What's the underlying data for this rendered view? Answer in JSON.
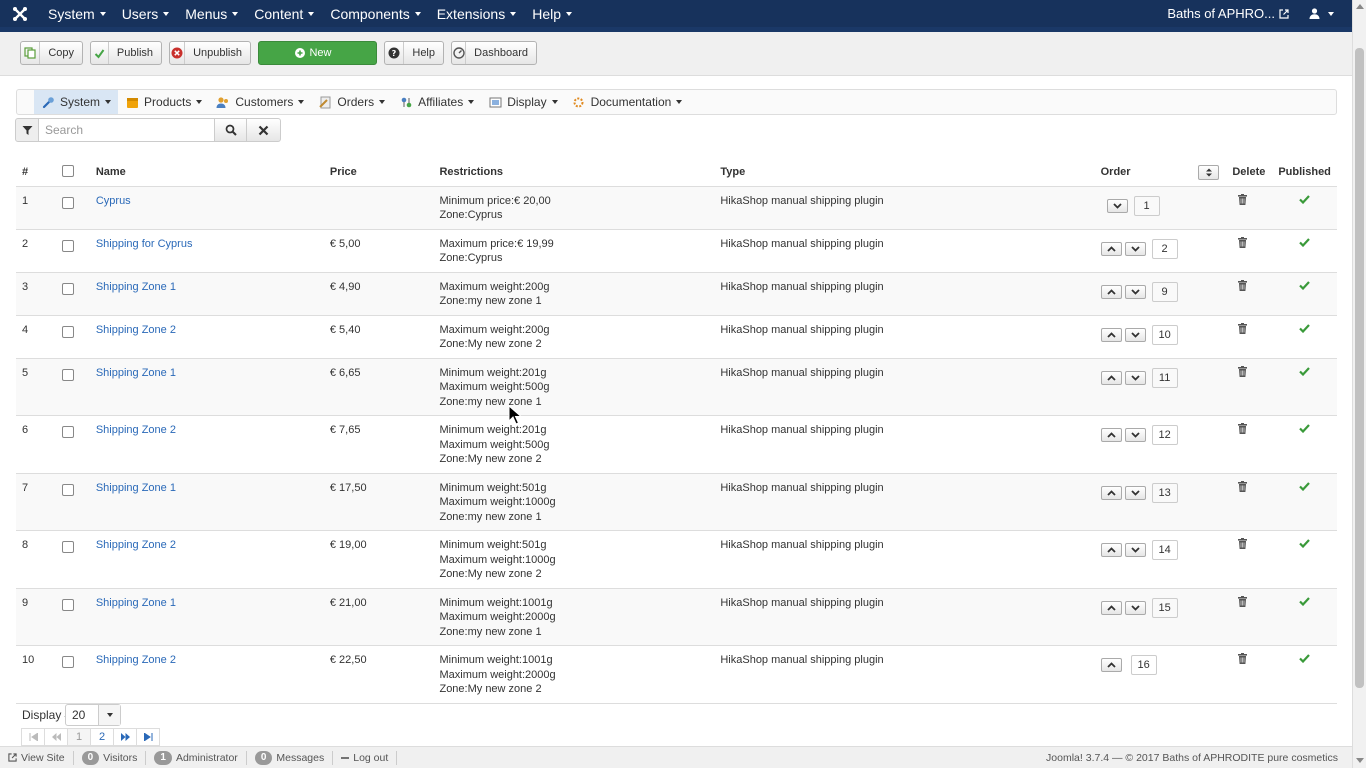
{
  "topnav": {
    "menus": [
      "System",
      "Users",
      "Menus",
      "Content",
      "Components",
      "Extensions",
      "Help"
    ],
    "site_link": "Baths of APHRO...",
    "user_icon": "user-icon",
    "logo_icon": "joomla-logo-icon",
    "bg_color": "#17325c"
  },
  "toolbar": {
    "copy": "Copy",
    "publish": "Publish",
    "unpublish": "Unpublish",
    "new": "New",
    "help": "Help",
    "dashboard": "Dashboard",
    "new_color": "#46a546"
  },
  "submenu": {
    "items": [
      "System",
      "Products",
      "Customers",
      "Orders",
      "Affiliates",
      "Display",
      "Documentation"
    ],
    "active": "System"
  },
  "search": {
    "placeholder": "Search",
    "value": ""
  },
  "table": {
    "headers": {
      "num": "#",
      "name": "Name",
      "price": "Price",
      "restrictions": "Restrictions",
      "type": "Type",
      "order": "Order",
      "delete": "Delete",
      "published": "Published"
    },
    "rows": [
      {
        "num": "1",
        "name": "Cyprus",
        "price": "",
        "r1": "Minimum price:€ 20,00",
        "r2": "Zone:Cyprus",
        "r3": "",
        "type": "HikaShop manual shipping plugin",
        "order": "1",
        "up": false,
        "down": true
      },
      {
        "num": "2",
        "name": "Shipping for Cyprus",
        "price": "€ 5,00",
        "r1": "Maximum price:€ 19,99",
        "r2": "Zone:Cyprus",
        "r3": "",
        "type": "HikaShop manual shipping plugin",
        "order": "2",
        "up": true,
        "down": true
      },
      {
        "num": "3",
        "name": "Shipping Zone 1",
        "price": "€ 4,90",
        "r1": "Maximum weight:200g",
        "r2": "Zone:my new zone 1",
        "r3": "",
        "type": "HikaShop manual shipping plugin",
        "order": "9",
        "up": true,
        "down": true
      },
      {
        "num": "4",
        "name": "Shipping Zone 2",
        "price": "€ 5,40",
        "r1": "Maximum weight:200g",
        "r2": "Zone:My new zone 2",
        "r3": "",
        "type": "HikaShop manual shipping plugin",
        "order": "10",
        "up": true,
        "down": true
      },
      {
        "num": "5",
        "name": "Shipping Zone 1",
        "price": "€ 6,65",
        "r1": "Minimum weight:201g",
        "r2": "Maximum weight:500g",
        "r3": "Zone:my new zone 1",
        "type": "HikaShop manual shipping plugin",
        "order": "11",
        "up": true,
        "down": true
      },
      {
        "num": "6",
        "name": "Shipping Zone 2",
        "price": "€ 7,65",
        "r1": "Minimum weight:201g",
        "r2": "Maximum weight:500g",
        "r3": "Zone:My new zone 2",
        "type": "HikaShop manual shipping plugin",
        "order": "12",
        "up": true,
        "down": true
      },
      {
        "num": "7",
        "name": "Shipping Zone 1",
        "price": "€ 17,50",
        "r1": "Minimum weight:501g",
        "r2": "Maximum weight:1000g",
        "r3": "Zone:my new zone 1",
        "type": "HikaShop manual shipping plugin",
        "order": "13",
        "up": true,
        "down": true
      },
      {
        "num": "8",
        "name": "Shipping Zone 2",
        "price": "€ 19,00",
        "r1": "Minimum weight:501g",
        "r2": "Maximum weight:1000g",
        "r3": "Zone:My new zone 2",
        "type": "HikaShop manual shipping plugin",
        "order": "14",
        "up": true,
        "down": true
      },
      {
        "num": "9",
        "name": "Shipping Zone 1",
        "price": "€ 21,00",
        "r1": "Minimum weight:1001g",
        "r2": "Maximum weight:2000g",
        "r3": "Zone:my new zone 1",
        "type": "HikaShop manual shipping plugin",
        "order": "15",
        "up": true,
        "down": true
      },
      {
        "num": "10",
        "name": "Shipping Zone 2",
        "price": "€ 22,50",
        "r1": "Minimum weight:1001g",
        "r2": "Maximum weight:2000g",
        "r3": "Zone:My new zone 2",
        "type": "HikaShop manual shipping plugin",
        "order": "16",
        "up": true,
        "down": false
      }
    ],
    "link_color": "#2a69b8",
    "published_color": "#3a9a3a"
  },
  "pagination": {
    "display_label": "Display #",
    "display_value": "20",
    "pages": [
      "1",
      "2"
    ],
    "current_page": "1"
  },
  "statusbar": {
    "view_site": "View Site",
    "visitors_count": "0",
    "visitors_label": "Visitors",
    "admin_count": "1",
    "admin_label": "Administrator",
    "messages_count": "0",
    "messages_label": "Messages",
    "logout": "Log out",
    "version": "Joomla! 3.7.4 — © 2017 Baths of APHRODITE pure cosmetics"
  }
}
